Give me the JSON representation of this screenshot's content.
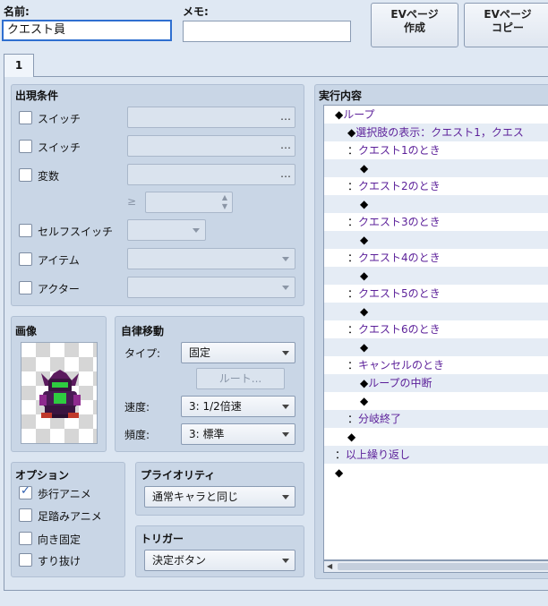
{
  "header": {
    "name_label": "名前:",
    "name_value": "クエスト員",
    "memo_label": "メモ:",
    "memo_value": "",
    "btn_create": [
      "EVページ",
      "作成"
    ],
    "btn_copy": [
      "EVページ",
      "コピー"
    ]
  },
  "tab": {
    "label": "1"
  },
  "conditions": {
    "title": "出現条件",
    "switch1": "スイッチ",
    "switch2": "スイッチ",
    "variable": "変数",
    "dots": "…",
    "ge": "≥",
    "self_switch": "セルフスイッチ",
    "item": "アイテム",
    "actor": "アクター"
  },
  "image": {
    "title": "画像"
  },
  "autonomous": {
    "title": "自律移動",
    "type_label": "タイプ:",
    "type_value": "固定",
    "route_button": "ルート...",
    "speed_label": "速度:",
    "speed_value": "3: 1/2倍速",
    "freq_label": "頻度:",
    "freq_value": "3: 標準"
  },
  "options": {
    "title": "オプション",
    "walking": "歩行アニメ",
    "stepping": "足踏みアニメ",
    "direction_fix": "向き固定",
    "through": "すり抜け",
    "walking_checked": true
  },
  "priority": {
    "title": "プライオリティ",
    "value": "通常キャラと同じ"
  },
  "trigger": {
    "title": "トリガー",
    "value": "決定ボタン"
  },
  "contents": {
    "title": "実行内容",
    "rows": [
      {
        "indent": 1,
        "mark": "◆",
        "text": "ループ"
      },
      {
        "indent": 2,
        "mark": "◆",
        "text": "選択肢の表示：クエスト1，クエス"
      },
      {
        "indent": 2,
        "mark": "：",
        "text": "クエスト1のとき"
      },
      {
        "indent": 3,
        "mark": "◆",
        "text": ""
      },
      {
        "indent": 2,
        "mark": "：",
        "text": "クエスト2のとき"
      },
      {
        "indent": 3,
        "mark": "◆",
        "text": ""
      },
      {
        "indent": 2,
        "mark": "：",
        "text": "クエスト3のとき"
      },
      {
        "indent": 3,
        "mark": "◆",
        "text": ""
      },
      {
        "indent": 2,
        "mark": "：",
        "text": "クエスト4のとき"
      },
      {
        "indent": 3,
        "mark": "◆",
        "text": ""
      },
      {
        "indent": 2,
        "mark": "：",
        "text": "クエスト5のとき"
      },
      {
        "indent": 3,
        "mark": "◆",
        "text": ""
      },
      {
        "indent": 2,
        "mark": "：",
        "text": "クエスト6のとき"
      },
      {
        "indent": 3,
        "mark": "◆",
        "text": ""
      },
      {
        "indent": 2,
        "mark": "：",
        "text": "キャンセルのとき"
      },
      {
        "indent": 3,
        "mark": "◆",
        "text": "ループの中断"
      },
      {
        "indent": 3,
        "mark": "◆",
        "text": ""
      },
      {
        "indent": 2,
        "mark": "：",
        "text": "分岐終了"
      },
      {
        "indent": 2,
        "mark": "◆",
        "text": ""
      },
      {
        "indent": 1,
        "mark": "：",
        "text": "以上繰り返し"
      },
      {
        "indent": 1,
        "mark": "◆",
        "text": ""
      }
    ]
  }
}
